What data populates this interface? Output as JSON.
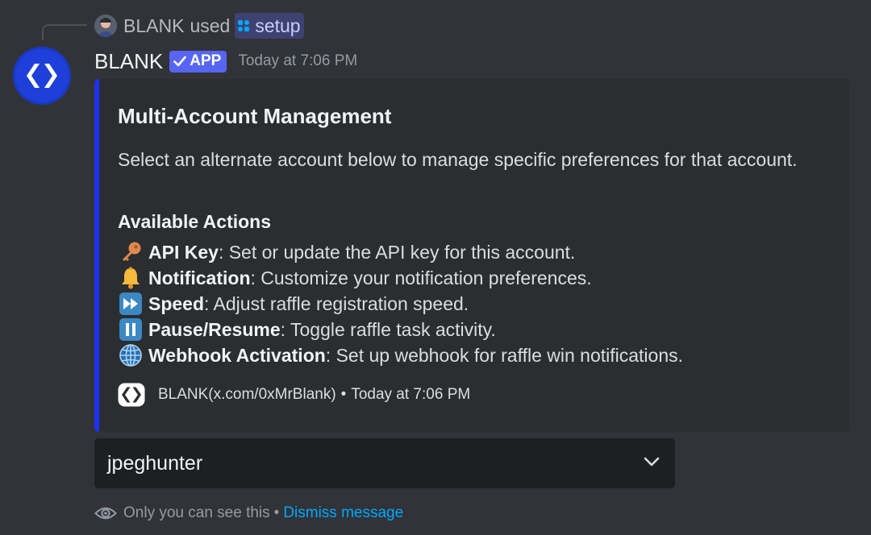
{
  "reply": {
    "author": "BLANK",
    "used_text": "used",
    "command": "setup"
  },
  "message": {
    "author": "BLANK",
    "app_tag": "APP",
    "timestamp": "Today at 7:06 PM"
  },
  "embed": {
    "accent_color": "#1c31f5",
    "title": "Multi-Account Management",
    "description": "Select an alternate account below to manage specific preferences for that account.",
    "section_title": "Available Actions",
    "actions": [
      {
        "icon": "key-icon",
        "name": "API Key",
        "text": ": Set or update the API key for this account."
      },
      {
        "icon": "bell-icon",
        "name": "Notification",
        "text": ": Customize your notification preferences."
      },
      {
        "icon": "fast-forward-icon",
        "name": "Speed",
        "text": ": Adjust raffle registration speed."
      },
      {
        "icon": "pause-icon",
        "name": "Pause/Resume",
        "text": ": Toggle raffle task activity."
      },
      {
        "icon": "globe-icon",
        "name": "Webhook Activation",
        "text": ": Set up webhook for raffle win notifications."
      }
    ],
    "footer": {
      "text": "BLANK(x.com/0xMrBlank)",
      "separator": "•",
      "timestamp": "Today at 7:06 PM"
    }
  },
  "select_menu": {
    "value": "jpeghunter"
  },
  "ephemeral_notice": {
    "text": "Only you can see this",
    "separator": "•",
    "dismiss": "Dismiss message"
  }
}
